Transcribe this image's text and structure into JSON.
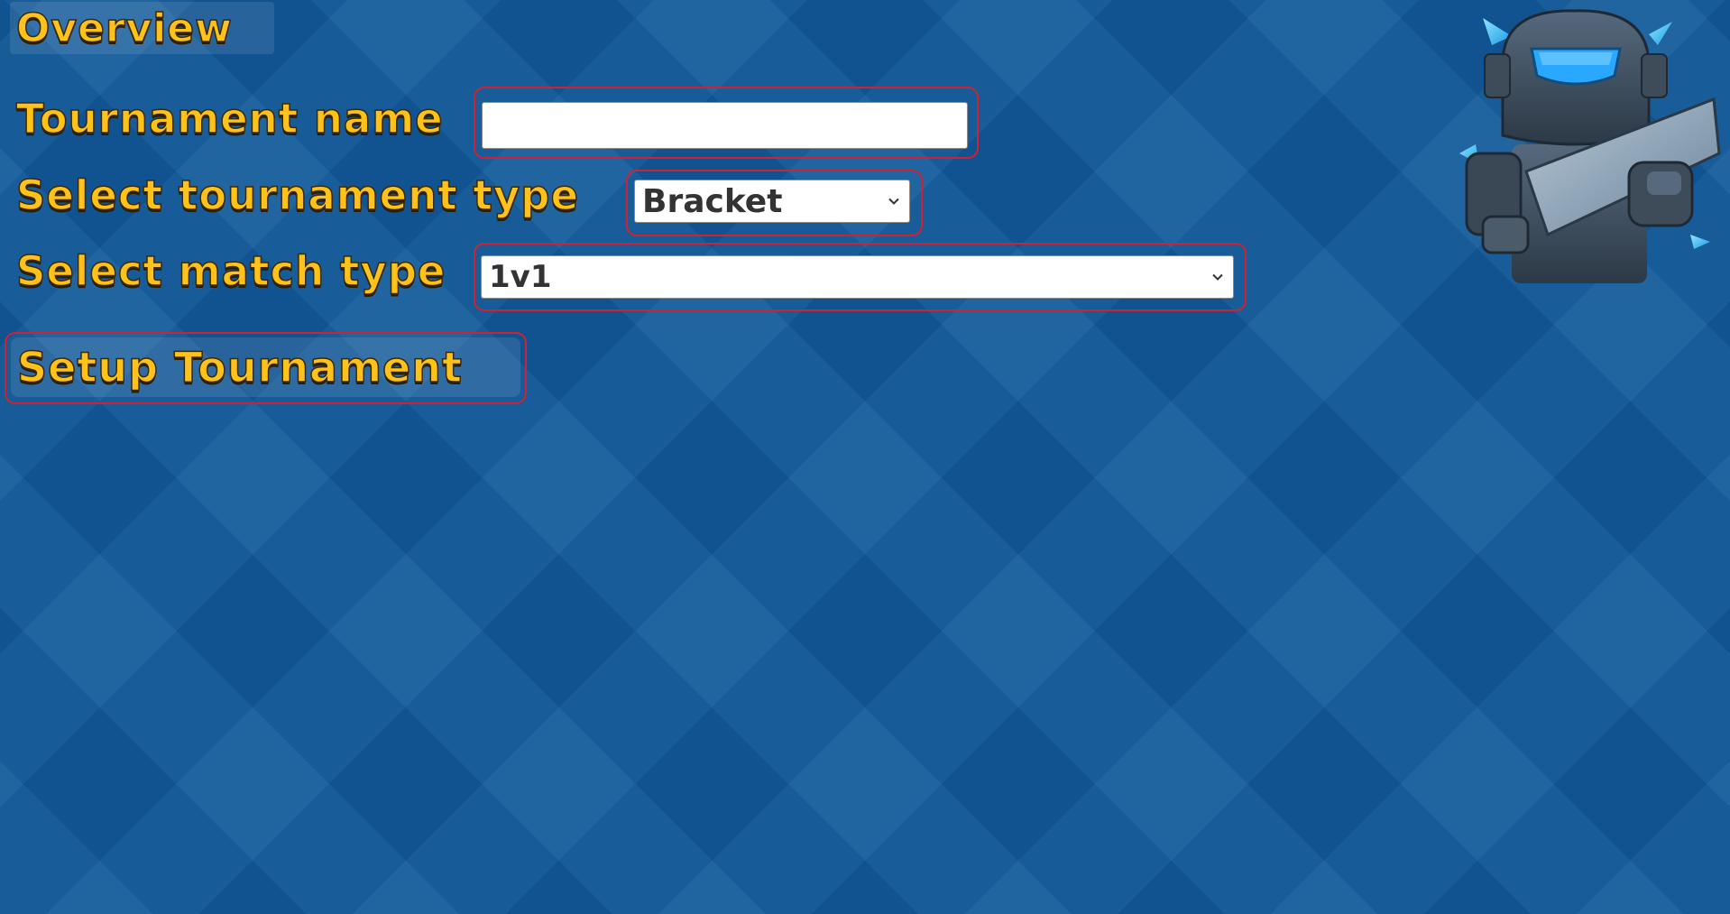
{
  "header": {
    "title": "Overview"
  },
  "form": {
    "tournament_name": {
      "label": "Tournament name",
      "value": "",
      "placeholder": ""
    },
    "tournament_type": {
      "label": "Select tournament type",
      "selected": "Bracket",
      "chevron_icon": "chevron-down-icon"
    },
    "match_type": {
      "label": "Select match type",
      "selected": "1v1",
      "chevron_icon": "chevron-down-icon"
    },
    "setup_button": {
      "label": "Setup Tournament"
    }
  },
  "theme": {
    "background": "#11599a",
    "label_color": "#ffc21a",
    "highlight_border": "#d12233"
  },
  "character": {
    "icon": "mini-pekka-character"
  }
}
